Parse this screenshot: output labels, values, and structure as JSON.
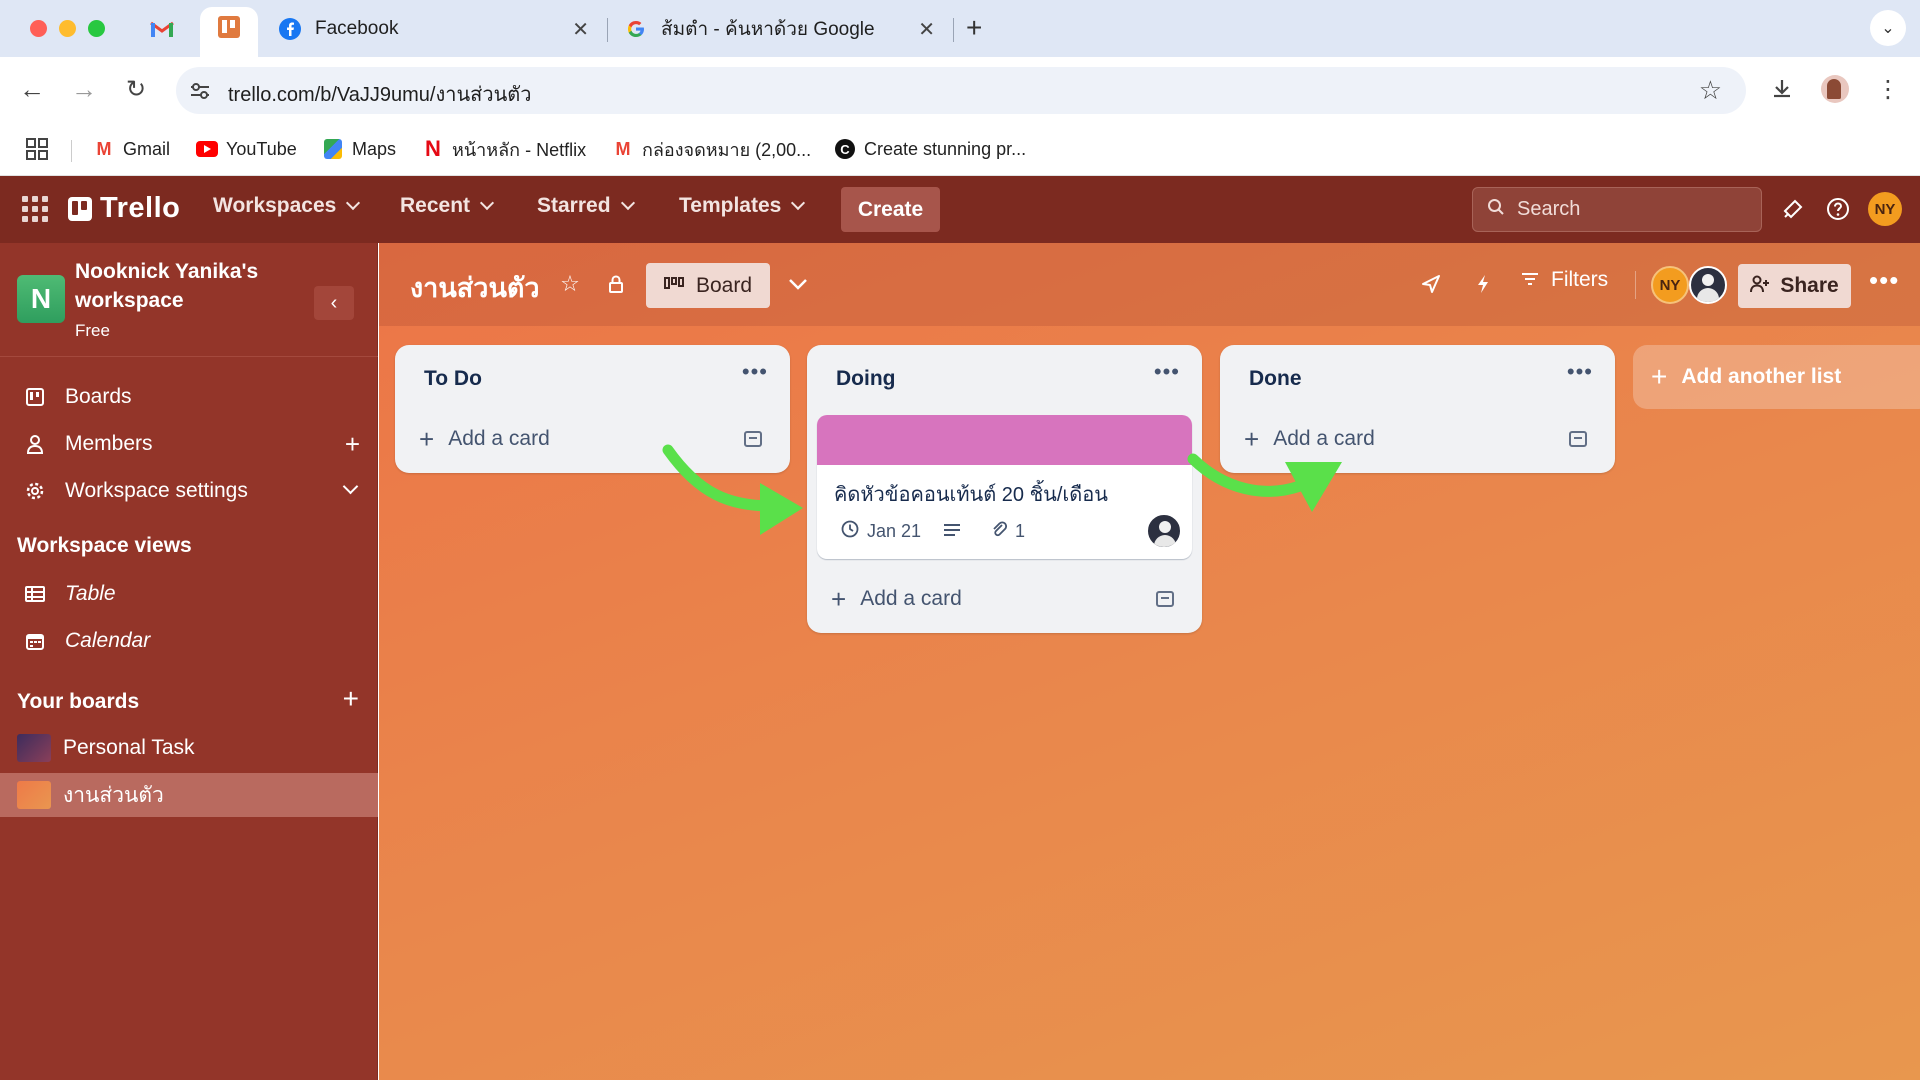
{
  "browser": {
    "tabs": [
      {
        "title": "Facebook"
      },
      {
        "title": "ส้มตำ - ค้นหาด้วย Google"
      }
    ],
    "url": "trello.com/b/VaJJ9umu/งานส่วนตัว",
    "bookmarks": [
      {
        "label": "Gmail"
      },
      {
        "label": "YouTube"
      },
      {
        "label": "Maps"
      },
      {
        "label": "หน้าหลัก - Netflix"
      },
      {
        "label": "กล่องจดหมาย (2,00..."
      },
      {
        "label": "Create stunning pr..."
      }
    ]
  },
  "header": {
    "logo": "Trello",
    "menus": [
      {
        "label": "Workspaces"
      },
      {
        "label": "Recent"
      },
      {
        "label": "Starred"
      },
      {
        "label": "Templates"
      }
    ],
    "create_label": "Create",
    "search_placeholder": "Search",
    "avatar_initials": "NY"
  },
  "sidebar": {
    "workspace_initial": "N",
    "workspace_name": "Nooknick Yanika's workspace",
    "workspace_plan": "Free",
    "items": [
      {
        "label": "Boards"
      },
      {
        "label": "Members"
      },
      {
        "label": "Workspace settings"
      }
    ],
    "views_heading": "Workspace views",
    "views": [
      {
        "label": "Table"
      },
      {
        "label": "Calendar"
      }
    ],
    "boards_heading": "Your boards",
    "boards": [
      {
        "label": "Personal Task",
        "color": "#6a3a5e"
      },
      {
        "label": "งานส่วนตัว",
        "color": "#ee7a48"
      }
    ]
  },
  "board": {
    "title": "งานส่วนตัว",
    "view_label": "Board",
    "filters_label": "Filters",
    "member_initials": "NY",
    "share_label": "Share",
    "lists": [
      {
        "title": "To Do",
        "add_label": "Add a card"
      },
      {
        "title": "Doing",
        "add_label": "Add a card",
        "card": {
          "cover_color": "#d774be",
          "title": "คิดหัวข้อคอนเท้นต์ 20 ชิ้น/เดือน",
          "due": "Jan 21",
          "attachments": "1"
        }
      },
      {
        "title": "Done",
        "add_label": "Add a card"
      }
    ],
    "add_list_label": "Add another list"
  },
  "colors": {
    "header": "#7c2a20",
    "sidebar": "#933529",
    "arrow": "#5ae04a"
  }
}
